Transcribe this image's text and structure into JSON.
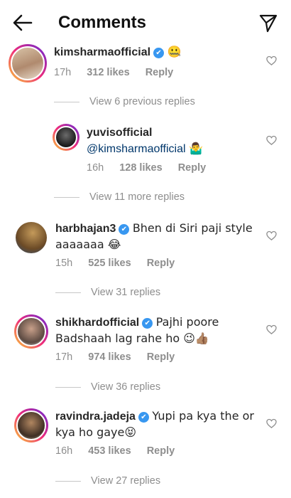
{
  "header": {
    "title": "Comments",
    "back_icon": "arrow-left-icon",
    "share_icon": "paper-plane-icon"
  },
  "comments": [
    {
      "username": "kimsharmaofficial",
      "verified": true,
      "text": "🤐",
      "time": "17h",
      "likes": "312 likes",
      "reply": "Reply"
    },
    {
      "username": "yuvisofficial",
      "verified": false,
      "mention": "@kimsharmaofficial",
      "text": "🤷‍♂️",
      "time": "16h",
      "likes": "128 likes",
      "reply": "Reply"
    },
    {
      "username": "harbhajan3",
      "verified": true,
      "text": "Bhen di Siri paji style aaaaaaa 😂",
      "time": "15h",
      "likes": "525 likes",
      "reply": "Reply"
    },
    {
      "username": "shikhardofficial",
      "verified": true,
      "text": "Pajhi poore Badshaah lag rahe ho 😉👍🏽",
      "time": "17h",
      "likes": "974 likes",
      "reply": "Reply"
    },
    {
      "username": "ravindra.jadeja",
      "verified": true,
      "text": "Yupi pa kya the or kya ho gaye😝",
      "time": "16h",
      "likes": "453 likes",
      "reply": "Reply"
    }
  ],
  "view_links": [
    "View 6 previous replies",
    "View 11 more replies",
    "View 31 replies",
    "View 36 replies",
    "View 27 replies"
  ],
  "colors": {
    "verified": "#3897f0",
    "mention": "#00376b",
    "meta": "#8e8e8e"
  }
}
